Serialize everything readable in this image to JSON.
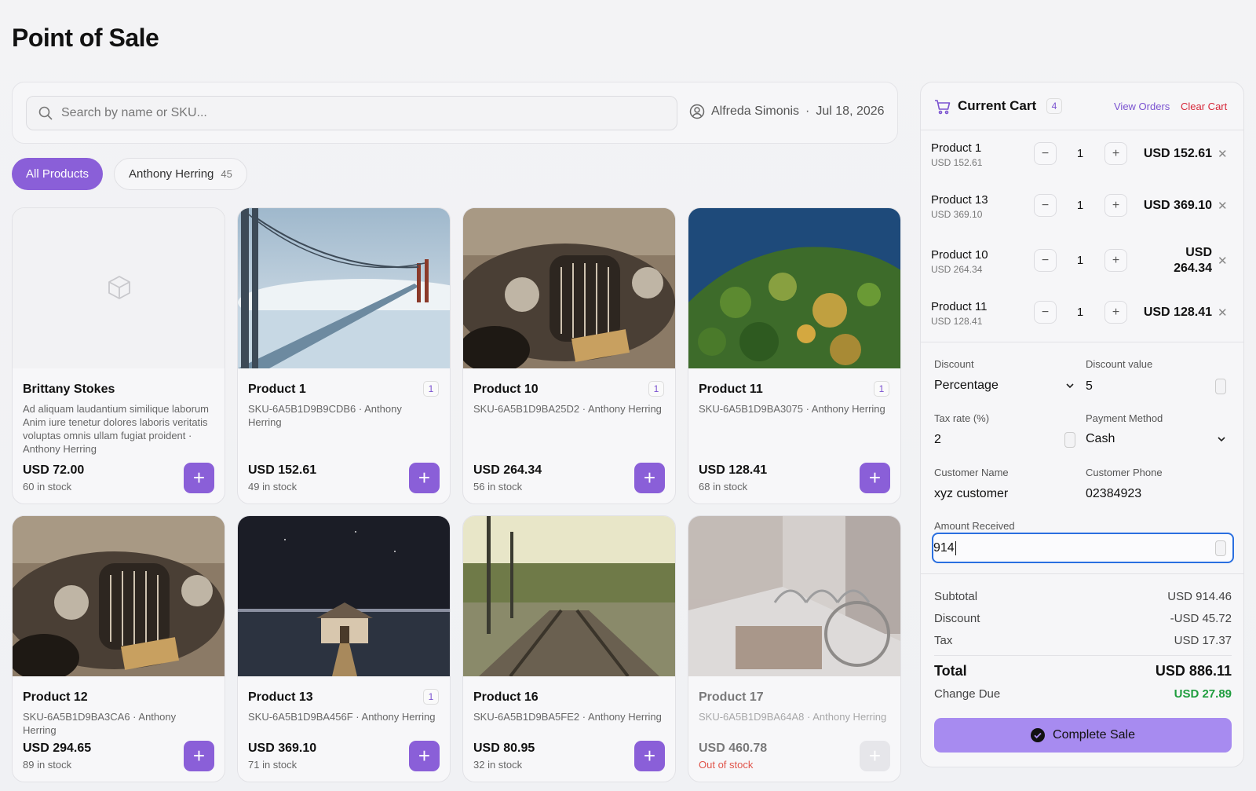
{
  "page": {
    "title": "Point of Sale"
  },
  "search": {
    "placeholder": "Search by name or SKU..."
  },
  "user": {
    "name": "Alfreda Simonis",
    "separator": "·",
    "date": "Jul 18, 2026"
  },
  "tabs": [
    {
      "label": "All Products",
      "active": true
    },
    {
      "label": "Anthony Herring",
      "count": "45"
    }
  ],
  "products": [
    {
      "name": "Brittany Stokes",
      "badge": "",
      "desc": "Ad aliquam laudantium similique laborum Anim iure tenetur dolores laboris veritatis voluptas omnis ullam fugiat proident · Anthony Herring",
      "price": "USD 72.00",
      "stock": "60 in stock",
      "image": "placeholder-box-icon"
    },
    {
      "name": "Product 1",
      "badge": "1",
      "desc": "SKU-6A5B1D9B9CDB6 · Anthony Herring",
      "price": "USD 152.61",
      "stock": "49 in stock",
      "image": "bridge-in-fog"
    },
    {
      "name": "Product 10",
      "badge": "1",
      "desc": "SKU-6A5B1D9BA25D2 · Anthony Herring",
      "price": "USD 264.34",
      "stock": "56 in stock",
      "image": "vintage-car"
    },
    {
      "name": "Product 11",
      "badge": "1",
      "desc": "SKU-6A5B1D9BA3075 · Anthony Herring",
      "price": "USD 128.41",
      "stock": "68 in stock",
      "image": "forest-aerial"
    },
    {
      "name": "Product 12",
      "badge": "",
      "desc": "SKU-6A5B1D9BA3CA6 · Anthony Herring",
      "price": "USD 294.65",
      "stock": "89 in stock",
      "image": "vintage-car"
    },
    {
      "name": "Product 13",
      "badge": "1",
      "desc": "SKU-6A5B1D9BA456F · Anthony Herring",
      "price": "USD 369.10",
      "stock": "71 in stock",
      "image": "boathouse-night"
    },
    {
      "name": "Product 16",
      "badge": "",
      "desc": "SKU-6A5B1D9BA5FE2 · Anthony Herring",
      "price": "USD 80.95",
      "stock": "32 in stock",
      "image": "railway-track"
    },
    {
      "name": "Product 17",
      "badge": "",
      "desc": "SKU-6A5B1D9BA64A8 · Anthony Herring",
      "price": "USD 460.78",
      "stock": "Out of stock",
      "image": "street-bicycle"
    }
  ],
  "cart": {
    "title": "Current Cart",
    "count": "4",
    "view_orders": "View Orders",
    "clear_cart": "Clear Cart",
    "items": [
      {
        "name": "Product 1",
        "unit": "USD 152.61",
        "qty": "1",
        "total": "USD 152.61"
      },
      {
        "name": "Product 13",
        "unit": "USD 369.10",
        "qty": "1",
        "total": "USD 369.10"
      },
      {
        "name": "Product 10",
        "unit": "USD 264.34",
        "qty": "1",
        "total": "USD 264.34"
      },
      {
        "name": "Product 11",
        "unit": "USD 128.41",
        "qty": "1",
        "total": "USD 128.41"
      }
    ],
    "form": {
      "discount_label": "Discount",
      "discount_type": "Percentage",
      "discount_value_label": "Discount value",
      "discount_value": "5",
      "tax_label": "Tax rate (%)",
      "tax_value": "2",
      "payment_label": "Payment Method",
      "payment_value": "Cash",
      "customer_name_label": "Customer Name",
      "customer_name": "xyz customer",
      "customer_phone_label": "Customer Phone",
      "customer_phone": "02384923",
      "amount_label": "Amount Received",
      "amount_value": "914"
    },
    "summary": {
      "subtotal_label": "Subtotal",
      "subtotal": "USD 914.46",
      "discount_label": "Discount",
      "discount": "-USD 45.72",
      "tax_label": "Tax",
      "tax": "USD 17.37",
      "total_label": "Total",
      "total": "USD 886.11",
      "change_label": "Change Due",
      "change": "USD 27.89"
    },
    "complete_label": "Complete Sale"
  },
  "colors": {
    "accent": "#8a5fd8",
    "danger": "#d6283a",
    "success": "#1f9d3e",
    "focus": "#2a6fe0"
  }
}
